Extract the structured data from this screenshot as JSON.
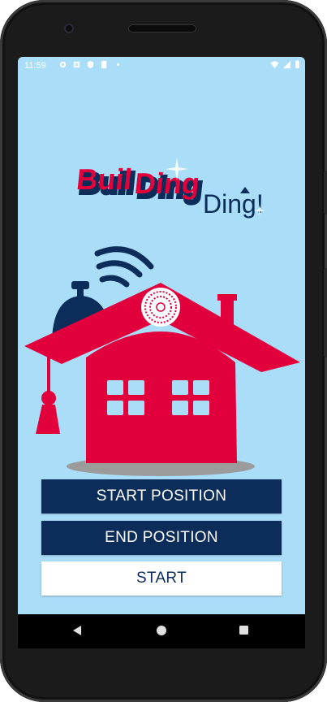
{
  "status_bar": {
    "time": "11:59",
    "left_icons": [
      "settings-icon",
      "notification-icon",
      "shield-icon",
      "sd-card-icon",
      "dot-icon"
    ],
    "right_icons": [
      "wifi-icon",
      "signal-icon",
      "battery-icon"
    ]
  },
  "logo": {
    "line1_a": "Buil",
    "line1_b": "Ding",
    "line2": "Ding!"
  },
  "buttons": {
    "start_position": "START POSITION",
    "end_position": "END POSITION",
    "start": "START"
  },
  "nav": {
    "back": "back-icon",
    "home": "home-icon",
    "recent": "recent-apps-icon"
  },
  "colors": {
    "background": "#a9ddf8",
    "brand_red": "#e1003c",
    "brand_navy": "#0c2d5a",
    "button_light": "#ffffff"
  }
}
